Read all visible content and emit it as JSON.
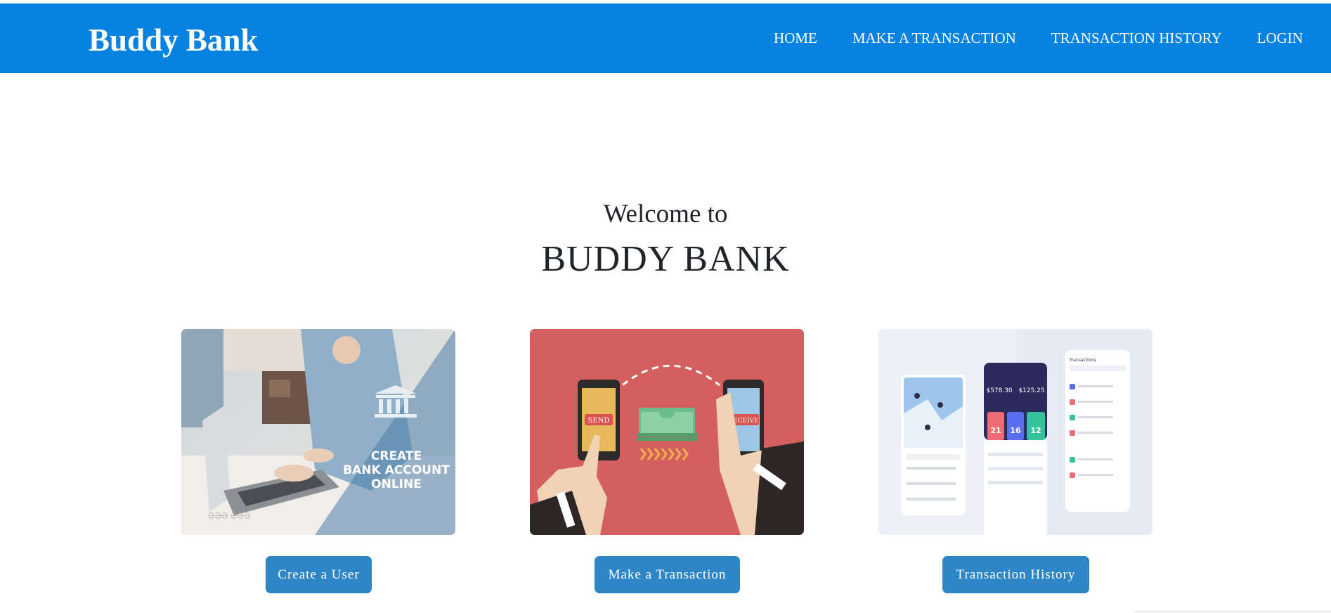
{
  "navbar": {
    "brand": "Buddy Bank",
    "links": [
      "HOME",
      "MAKE A TRANSACTION",
      "TRANSACTION HISTORY",
      "LOGIN"
    ],
    "background": "#0682e3"
  },
  "hero": {
    "welcome": "Welcome to",
    "title": "BUDDY BANK"
  },
  "cards": [
    {
      "image": {
        "icon": "bank-building-icon",
        "caption_lines": [
          "CREATE",
          "BANK ACCOUNT",
          "ONLINE"
        ],
        "watermark": "ƏƏƏ ƏƏƏ"
      },
      "button": "Create a User"
    },
    {
      "image": {
        "send_label": "SEND",
        "receive_label": "RECEIVE"
      },
      "button": "Make a Transaction"
    },
    {
      "image": {
        "balance_left": "$578.30",
        "balance_right": "$125.25",
        "stat_values": [
          "21",
          "16",
          "12"
        ],
        "panel_title": "Transactions"
      },
      "button": "Transaction History"
    }
  ],
  "colors": {
    "button": "#2e86c7",
    "card2_bg": "#d45f5f"
  }
}
